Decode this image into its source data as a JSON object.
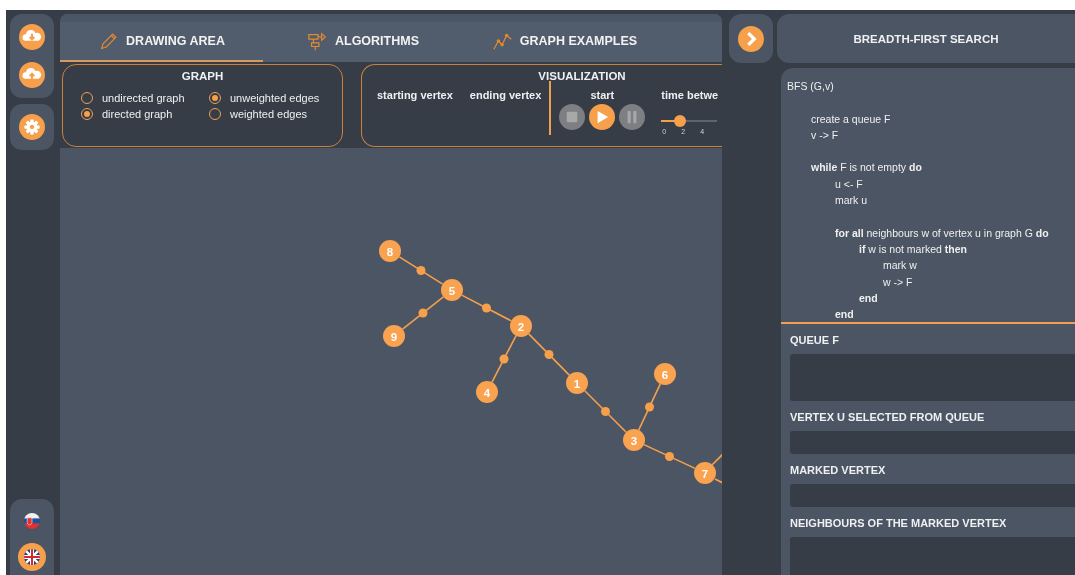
{
  "sidebar": {
    "top_buttons": [
      {
        "kind": "download"
      },
      {
        "kind": "upload"
      }
    ],
    "settings": {
      "kind": "settings"
    },
    "languages": [
      {
        "kind": "sk",
        "selected": false
      },
      {
        "kind": "en",
        "selected": true
      }
    ]
  },
  "tabs": [
    {
      "label": "DRAWING AREA",
      "kind": "pencil",
      "selected": true
    },
    {
      "label": "ALGORITHMS",
      "kind": "flowchart",
      "selected": false
    },
    {
      "label": "GRAPH EXAMPLES",
      "kind": "chart",
      "selected": false
    }
  ],
  "graph_card": {
    "title": "GRAPH",
    "options": [
      {
        "label": "undirected graph",
        "checked": false
      },
      {
        "label": "unweighted edges",
        "checked": true
      },
      {
        "label": "directed graph",
        "checked": true
      },
      {
        "label": "weighted edges",
        "checked": false
      }
    ]
  },
  "visualization_card": {
    "title": "VISUALIZATION",
    "starting_vertex": "starting vertex",
    "ending_vertex": "ending vertex",
    "start": "start",
    "controls": [
      {
        "kind": "stop",
        "disabled": true
      },
      {
        "kind": "play",
        "disabled": false
      },
      {
        "kind": "pause",
        "disabled": true
      }
    ],
    "time_label": "time betwe",
    "slider": {
      "level": 0.33,
      "ticks": [
        "0",
        "2",
        "4"
      ]
    }
  },
  "graph": {
    "nodes": [
      "8",
      "5",
      "9",
      "2",
      "4",
      "1",
      "6",
      "3",
      "7"
    ]
  },
  "algorithm": {
    "title": "BREADTH-FIRST SEARCH",
    "code": [
      {
        "kind": "line",
        "text": "BFS (G,v)",
        "keyword": false,
        "children": [
          {
            "kind": "blank"
          },
          {
            "kind": "line",
            "text": "create a queue F",
            "keyword": false
          },
          {
            "kind": "line",
            "text": "v -> F",
            "keyword": false
          },
          {
            "kind": "blank"
          },
          {
            "kind": "line",
            "text": "**while** F is not empty **do**",
            "keyword": false,
            "children": [
              {
                "kind": "line",
                "text": "u <- F",
                "keyword": false
              },
              {
                "kind": "line",
                "text": "mark u",
                "keyword": false
              },
              {
                "kind": "blank"
              },
              {
                "kind": "line",
                "text": "**for all** neighbours w of vertex u in graph G **do**",
                "keyword": false,
                "children": [
                  {
                    "kind": "line",
                    "text": "**if** w is not marked **then**",
                    "keyword": false,
                    "children": [
                      {
                        "kind": "line",
                        "text": "mark w",
                        "keyword": false
                      },
                      {
                        "kind": "line",
                        "text": "w -> F",
                        "keyword": false
                      }
                    ]
                  },
                  {
                    "kind": "line",
                    "text": "end",
                    "keyword": true
                  }
                ]
              },
              {
                "kind": "line",
                "text": "end",
                "keyword": true
              }
            ]
          }
        ]
      }
    ],
    "sections": [
      {
        "label": "QUEUE F",
        "kind": "tall"
      },
      {
        "label": "VERTEX U SELECTED FROM QUEUE",
        "kind": "short"
      },
      {
        "label": "MARKED VERTEX",
        "kind": "short"
      },
      {
        "label": "NEIGHBOURS OF THE MARKED VERTEX",
        "kind": "tall"
      }
    ]
  }
}
